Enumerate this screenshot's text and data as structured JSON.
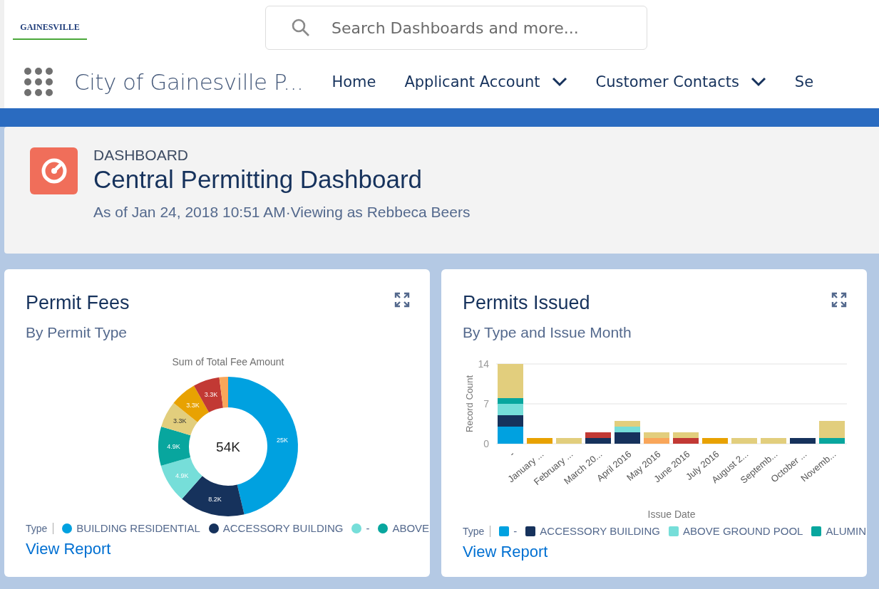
{
  "header": {
    "logo_text": "GAINESVILLE",
    "search": {
      "placeholder": "Search Dashboards and more..."
    }
  },
  "nav": {
    "app_name": "City of Gainesville P...",
    "items": [
      {
        "label": "Home",
        "dropdown": false
      },
      {
        "label": "Applicant Account",
        "dropdown": true
      },
      {
        "label": "Customer Contacts",
        "dropdown": true
      },
      {
        "label": "Se",
        "dropdown": false
      }
    ]
  },
  "dashboard": {
    "kind_label": "DASHBOARD",
    "title": "Central Permitting Dashboard",
    "subtitle": "As of Jan 24, 2018 10:51 AM·Viewing as Rebbeca Beers"
  },
  "cards": [
    {
      "title": "Permit Fees",
      "subtitle": "By Permit Type",
      "legend_title": "Type",
      "link": "View Report",
      "center_label": "54K",
      "legend": [
        {
          "label": "BUILDING RESIDENTIAL",
          "color": "#00a1e0"
        },
        {
          "label": "ACCESSORY BUILDING",
          "color": "#16325c"
        },
        {
          "label": "-",
          "color": "#76ded9"
        },
        {
          "label": "ABOVE",
          "color": "#08a69e"
        }
      ],
      "slices": [
        {
          "color": "#00a1e0"
        },
        {
          "color": "#16325c"
        },
        {
          "color": "#76ded9"
        },
        {
          "color": "#08a69e"
        },
        {
          "color": "#e2ce7d"
        },
        {
          "color": "#e8a202"
        },
        {
          "color": "#c23934"
        },
        {
          "color": "#f9a65a"
        }
      ],
      "chart_data": {
        "type": "donut",
        "title": "Sum of Total Fee Amount",
        "values": [
          25,
          8.2,
          4.9,
          4.9,
          3.3,
          3.3,
          3.3,
          1.1
        ],
        "value_labels": [
          "25K",
          "8.2K",
          "4.9K",
          "4.9K",
          "3.3K",
          "3.3K",
          "3.3K",
          null
        ]
      }
    },
    {
      "title": "Permits Issued",
      "subtitle": "By Type and Issue Month",
      "legend_title": "Type",
      "link": "View Report",
      "chart_data": {
        "type": "bar",
        "stacked": true,
        "xlabel": "Issue Date",
        "ylabel": "Record Count",
        "yticks": [
          0,
          7,
          14
        ],
        "ylim": [
          0,
          14
        ],
        "categories": [
          "-",
          "January ...",
          "February ...",
          "March 20...",
          "April 2016",
          "May 2016",
          "June 2016",
          "July 2016",
          "August 2...",
          "Septemb...",
          "October ...",
          "Novemb..."
        ],
        "series": [
          {
            "name": "-",
            "color": "#00a1e0",
            "values": [
              3,
              0,
              0,
              0,
              0,
              0,
              0,
              0,
              0,
              0,
              0,
              0
            ]
          },
          {
            "name": "ACCESSORY BUILDING",
            "color": "#16325c",
            "values": [
              2,
              0,
              0,
              1,
              2,
              0,
              0,
              0,
              0,
              0,
              1,
              0
            ]
          },
          {
            "name": "ABOVE GROUND POOL",
            "color": "#76ded9",
            "values": [
              2,
              0,
              0,
              0,
              1,
              0,
              0,
              0,
              0,
              0,
              0,
              0
            ]
          },
          {
            "name": "ALUMIN",
            "color": "#08a69e",
            "values": [
              1,
              0,
              0,
              0,
              0,
              0,
              0,
              0,
              0,
              0,
              0,
              1
            ]
          },
          {
            "color": "#c23934",
            "values": [
              0,
              0,
              0,
              1,
              0,
              0,
              1,
              0,
              0,
              0,
              0,
              0
            ]
          },
          {
            "color": "#e8a202",
            "values": [
              0,
              1,
              0,
              0,
              0,
              0,
              0,
              1,
              0,
              0,
              0,
              0
            ]
          },
          {
            "color": "#f9a65a",
            "values": [
              0,
              0,
              0,
              0,
              0,
              1,
              0,
              0,
              0,
              0,
              0,
              0
            ]
          },
          {
            "color": "#e2ce7d",
            "values": [
              6,
              0,
              1,
              0,
              1,
              1,
              1,
              0,
              1,
              1,
              0,
              3
            ]
          }
        ]
      }
    }
  ]
}
